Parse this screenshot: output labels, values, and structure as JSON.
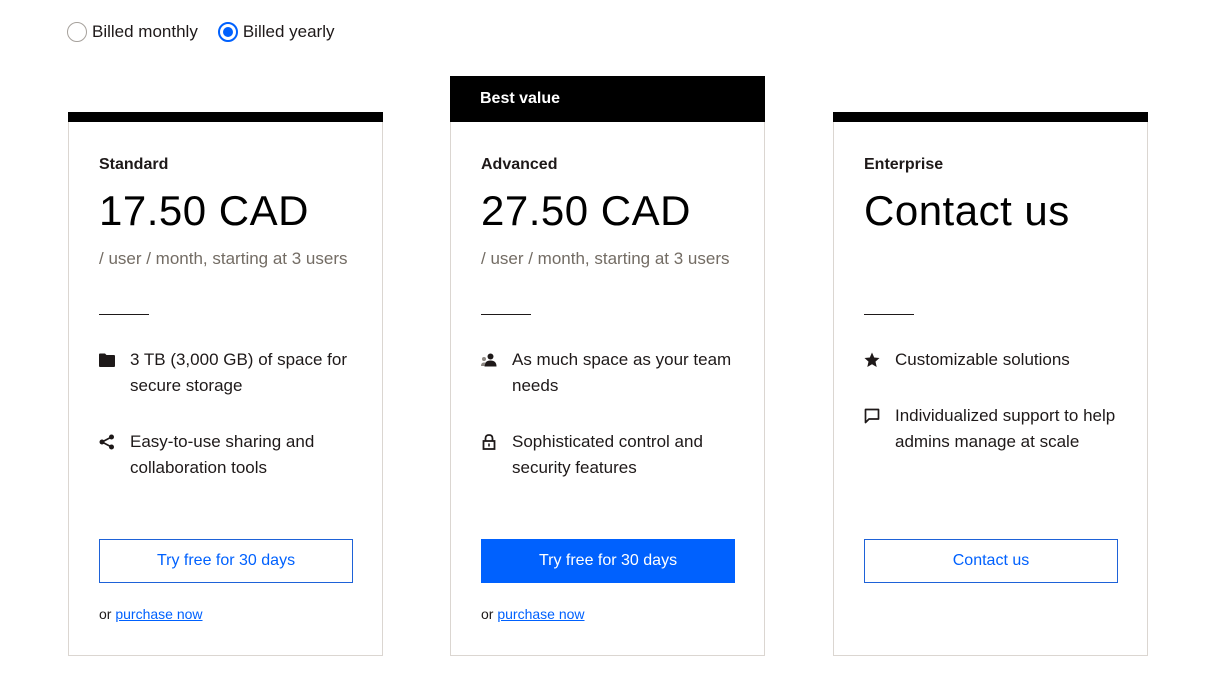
{
  "billing": {
    "options": [
      {
        "label": "Billed monthly",
        "checked": false
      },
      {
        "label": "Billed yearly",
        "checked": true
      }
    ]
  },
  "plans": [
    {
      "name": "Standard",
      "price": "17.50 CAD",
      "period": "/ user / month, starting at 3 users",
      "features": [
        {
          "icon": "folder-icon",
          "text": "3 TB (3,000 GB) of space for secure storage"
        },
        {
          "icon": "share-icon",
          "text": "Easy-to-use sharing and collaboration tools"
        }
      ],
      "cta": "Try free for 30 days",
      "purchase_prefix": "or",
      "purchase_link": "purchase now"
    },
    {
      "badge": "Best value",
      "name": "Advanced",
      "price": "27.50 CAD",
      "period": "/ user / month, starting at 3 users",
      "features": [
        {
          "icon": "team-icon",
          "text": "As much space as your team needs"
        },
        {
          "icon": "lock-icon",
          "text": "Sophisticated control and security features"
        }
      ],
      "cta": "Try free for 30 days",
      "purchase_prefix": "or",
      "purchase_link": "purchase now"
    },
    {
      "name": "Enterprise",
      "price": "Contact us",
      "features": [
        {
          "icon": "star-icon",
          "text": "Customizable solutions"
        },
        {
          "icon": "chat-icon",
          "text": "Individualized support to help admins manage at scale"
        }
      ],
      "cta": "Contact us"
    }
  ],
  "colors": {
    "accent": "#0061fe",
    "border": "#dbd6d1",
    "topbar": "#000000",
    "muted": "#736c64"
  }
}
